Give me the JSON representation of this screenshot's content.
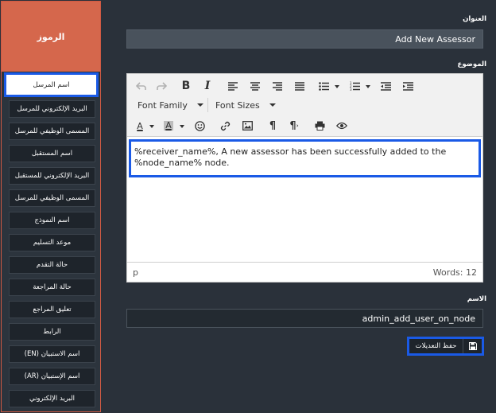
{
  "sidebar": {
    "header": "الرموز",
    "items": [
      {
        "label": "اسم المرسل"
      },
      {
        "label": "البريد الإلكتروني للمرسل"
      },
      {
        "label": "المسمى الوظيفي للمرسل"
      },
      {
        "label": "اسم المستقبل"
      },
      {
        "label": "البريد الإلكتروني للمستقبل"
      },
      {
        "label": "المسمى الوظيفي للمرسل"
      },
      {
        "label": "اسم النموذج"
      },
      {
        "label": "موعد التسليم"
      },
      {
        "label": "حالة التقدم"
      },
      {
        "label": "حالة المراجعة"
      },
      {
        "label": "تعليق المراجع"
      },
      {
        "label": "الرابط"
      },
      {
        "label": "اسم الاستبيان (EN)"
      },
      {
        "label": "اسم الإستبيان (AR)"
      },
      {
        "label": "البريد الإلكتروني"
      }
    ]
  },
  "form": {
    "title_label": "العنوان",
    "title_value": "Add New Assessor",
    "subject_label": "الموضوع",
    "editor": {
      "font_family": "Font Family",
      "font_sizes": "Font Sizes",
      "content": "%receiver_name%, A new assessor has been successfully added to the %node_name% node.",
      "path": "p",
      "word_count": "Words: 12"
    },
    "name_label": "الاسم",
    "name_value": "admin_add_user_on_node",
    "save_label": "حفظ التعديلات"
  },
  "colors": {
    "accent": "#d5674c",
    "highlight": "#1a5ae6",
    "background": "#2a313a"
  }
}
